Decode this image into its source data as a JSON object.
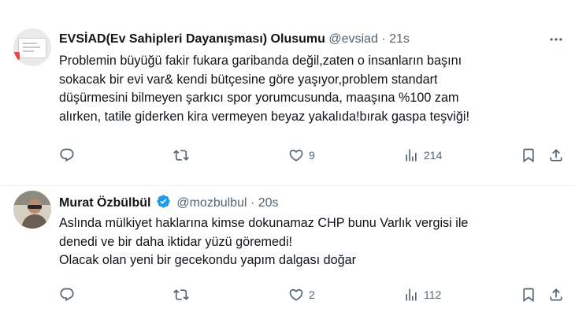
{
  "tweets": [
    {
      "author": "EVSİAD(Ev Sahipleri Dayanışması) Olusumu",
      "handle": "@evsiad",
      "time": "21s",
      "text_lines": [
        "Problemin büyüğü fakir fukara garibanda değil,zaten o insanların başını",
        "sokacak bir evi var& kendi bütçesine göre yaşıyor,problem standart",
        "düşürmesini bilmeyen şarkıcı spor yorumcusunda, maaşına %100 zam",
        "alırken, tatile giderken kira vermeyen beyaz yakalıda!bırak gaspa teşviği!"
      ],
      "replies": "",
      "retweets": "",
      "likes": "9",
      "views": "214"
    },
    {
      "author": "Murat Özbülbül",
      "handle": "@mozbulbul",
      "time": "20s",
      "text_lines": [
        "Aslında mülkiyet haklarına kimse dokunamaz CHP bunu Varlık vergisi ile",
        "denedi ve bir daha iktidar yüzü göremedi!",
        "Olacak olan yeni bir gecekondu yapım dalgası doğar"
      ],
      "replies": "",
      "retweets": "",
      "likes": "2",
      "views": "112"
    }
  ],
  "separator": "·",
  "icons": [
    "reply-icon",
    "retweet-icon",
    "like-icon",
    "views-icon",
    "bookmark-icon",
    "share-icon",
    "more-icon",
    "verified-badge-icon"
  ],
  "colors": {
    "text": "#0f1419",
    "muted": "#536471",
    "verified": "#1d9bf0",
    "divider": "#eff3f4"
  }
}
